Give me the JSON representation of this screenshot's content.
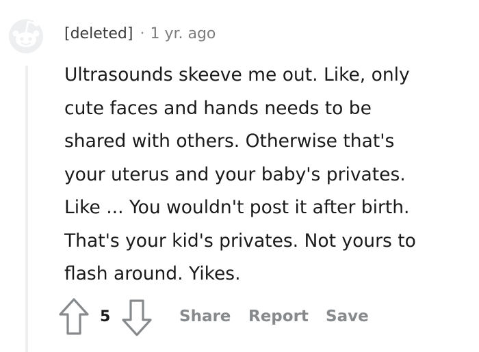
{
  "comment": {
    "author": "[deleted]",
    "separator": "·",
    "timestamp": "1 yr. ago",
    "body_lines": [
      "Ultrasounds skeeve me out. Like, only",
      "cute faces and hands needs to be",
      "shared with others. Otherwise that's",
      "your uterus and your baby's privates.",
      "Like ... You wouldn't post it after birth.",
      "That's your kid's privates. Not yours to",
      "flash around. Yikes."
    ],
    "score": "5"
  },
  "actions": {
    "share_label": "Share",
    "report_label": "Report",
    "save_label": "Save"
  },
  "icons": {
    "avatar": "snoo-avatar-icon",
    "upvote": "upvote-arrow-icon",
    "downvote": "downvote-arrow-icon"
  },
  "colors": {
    "text": "#1a1a1b",
    "muted": "#878a8c",
    "avatar_bg": "#edeff1",
    "thread_line": "#edeff1"
  }
}
